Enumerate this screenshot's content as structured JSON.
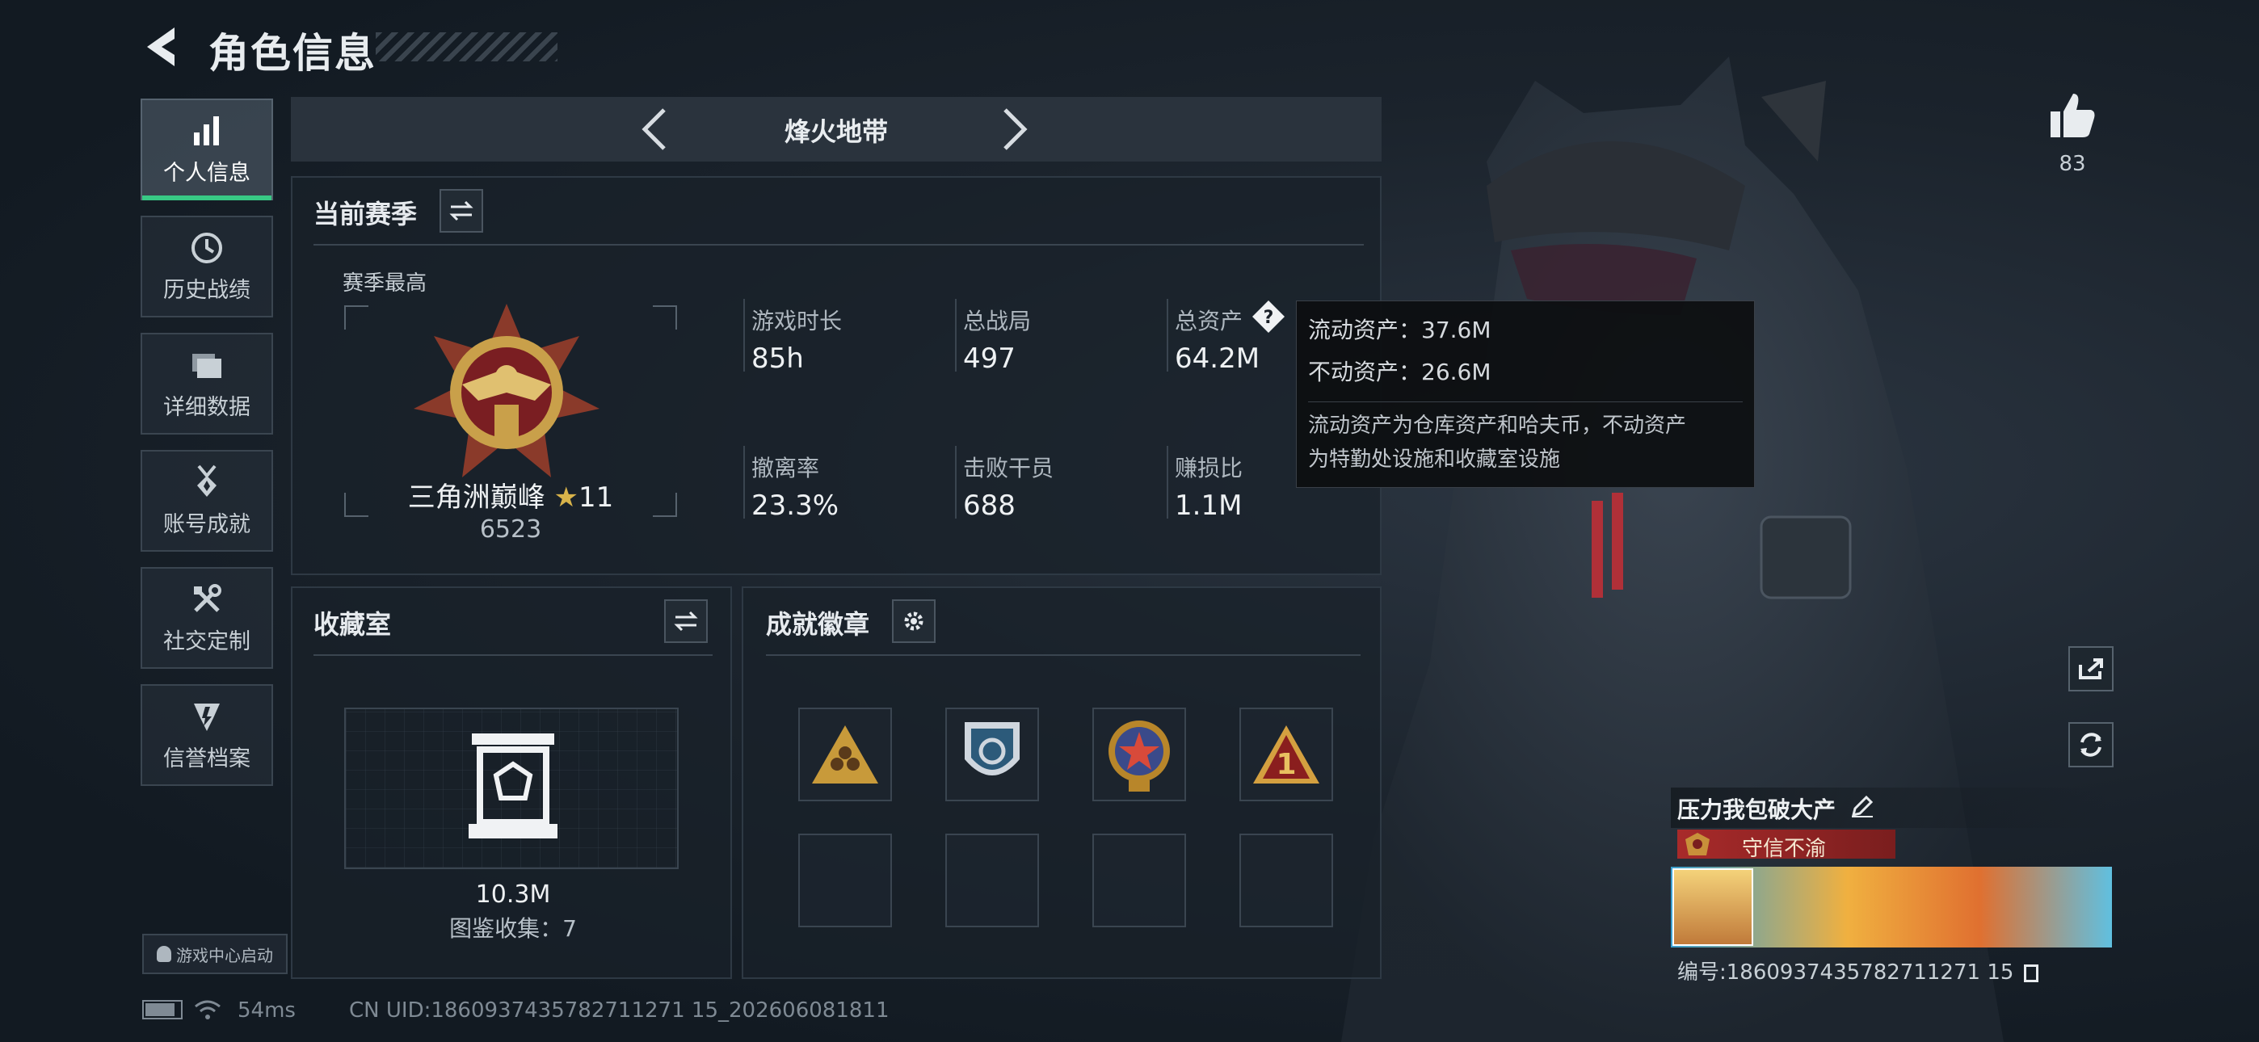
{
  "header": {
    "title": "角色信息"
  },
  "sidebar": {
    "items": [
      {
        "label": "个人信息",
        "icon": "bar-chart-icon",
        "active": true
      },
      {
        "label": "历史战绩",
        "icon": "clock-icon"
      },
      {
        "label": "详细数据",
        "icon": "folders-icon"
      },
      {
        "label": "账号成就",
        "icon": "medal-icon"
      },
      {
        "label": "社交定制",
        "icon": "tools-icon"
      },
      {
        "label": "信誉档案",
        "icon": "shield-icon"
      }
    ],
    "launch_label": "游戏中心启动"
  },
  "mode": {
    "name": "烽火地带"
  },
  "season": {
    "title": "当前赛季",
    "best_label": "赛季最高",
    "rank_name": "三角洲巅峰",
    "rank_stars": "11",
    "rank_score": "6523",
    "stats": [
      {
        "label": "游戏时长",
        "value": "85h"
      },
      {
        "label": "总战局",
        "value": "497"
      },
      {
        "label": "总资产",
        "value": "64.2M"
      },
      {
        "label": "撤离率",
        "value": "23.3%"
      },
      {
        "label": "击败干员",
        "value": "688"
      },
      {
        "label": "赚损比",
        "value": "1.1M"
      }
    ]
  },
  "tooltip": {
    "liquid": "流动资产：37.6M",
    "fixed": "不动资产：26.6M",
    "desc_line1": "流动资产为仓库资产和哈夫币，不动资产",
    "desc_line2": "为特勤处设施和收藏室设施"
  },
  "collection": {
    "title": "收藏室",
    "value": "10.3M",
    "catalog": "图鉴收集：7"
  },
  "badges": {
    "title": "成就徽章"
  },
  "likes": {
    "count": "83"
  },
  "profile": {
    "name": "压力我包破大产",
    "credit": "守信不渝",
    "id_text": "编号:1860937435782711271 15"
  },
  "footer": {
    "ping": "54ms",
    "uid": "CN UID:1860937435782711271 15_202606081811"
  },
  "colors": {
    "accent": "#38c985",
    "panel": "#19212a",
    "credit_badge": "#9a2a2a"
  }
}
